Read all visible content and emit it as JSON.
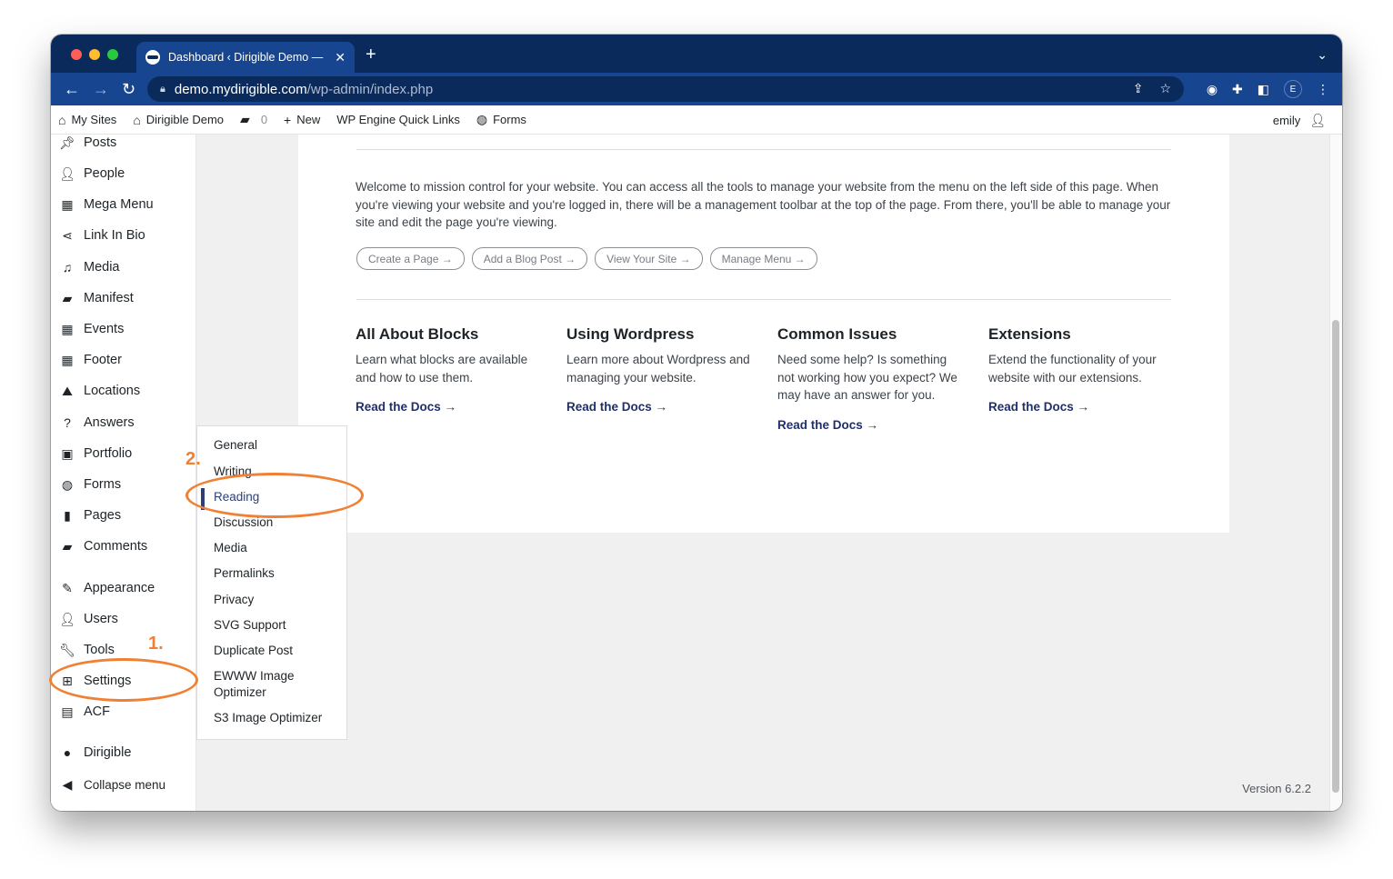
{
  "browser": {
    "tab_title": "Dashboard ‹ Dirigible Demo —",
    "tab_close": "✕",
    "new_tab": "+",
    "url_host": "demo.mydirigible.com",
    "url_path": "/wp-admin/index.php",
    "profile_initial": "E"
  },
  "adminbar": {
    "my_sites": "My Sites",
    "site_name": "Dirigible Demo",
    "comments_count": "0",
    "new_label": "New",
    "wp_engine": "WP Engine Quick Links",
    "forms": "Forms",
    "user": "emily"
  },
  "sidebar": {
    "items": [
      {
        "label": "Posts",
        "icon": "pin-icon"
      },
      {
        "label": "People",
        "icon": "person-icon"
      },
      {
        "label": "Mega Menu",
        "icon": "grid-icon"
      },
      {
        "label": "Link In Bio",
        "icon": "share-icon"
      },
      {
        "label": "Media",
        "icon": "media-icon"
      },
      {
        "label": "Manifest",
        "icon": "folder-icon"
      },
      {
        "label": "Events",
        "icon": "calendar-icon"
      },
      {
        "label": "Footer",
        "icon": "grid-icon"
      },
      {
        "label": "Locations",
        "icon": "map-icon"
      },
      {
        "label": "Answers",
        "icon": "question-icon"
      },
      {
        "label": "Portfolio",
        "icon": "portfolio-icon"
      },
      {
        "label": "Forms",
        "icon": "forms-icon"
      },
      {
        "label": "Pages",
        "icon": "pages-icon"
      },
      {
        "label": "Comments",
        "icon": "comment-icon"
      },
      {
        "label": "Appearance",
        "icon": "brush-icon"
      },
      {
        "label": "Users",
        "icon": "person-icon"
      },
      {
        "label": "Tools",
        "icon": "wrench-icon"
      },
      {
        "label": "Settings",
        "icon": "settings-icon"
      },
      {
        "label": "ACF",
        "icon": "acf-icon"
      },
      {
        "label": "Dirigible",
        "icon": "dirigible-icon"
      },
      {
        "label": "Collapse menu",
        "icon": "collapse-icon"
      }
    ]
  },
  "welcome": {
    "text": "Welcome to mission control for your website. You can access all the tools to manage your website from the menu on the left side of this page. When you're viewing your website and you're logged in, there will be a management toolbar at the top of the page. From there, you'll be able to manage your site and edit the page you're viewing.",
    "buttons": [
      "Create a Page →",
      "Add a Blog Post →",
      "View Your Site →",
      "Manage Menu →"
    ]
  },
  "columns": [
    {
      "title": "All About Blocks",
      "text": "Learn what blocks are available and how to use them.",
      "link": "Read the Docs →"
    },
    {
      "title": "Using Wordpress",
      "text": "Learn more about Wordpress and managing your website.",
      "link": "Read the Docs →"
    },
    {
      "title": "Common Issues",
      "text": "Need some help? Is something not working how you expect? We may have an answer for you.",
      "link": "Read the Docs →"
    },
    {
      "title": "Extensions",
      "text": "Extend the functionality of your website with our extensions.",
      "link": "Read the Docs →"
    }
  ],
  "settings_submenu": {
    "items": [
      "General",
      "Writing",
      "Reading",
      "Discussion",
      "Media",
      "Permalinks",
      "Privacy",
      "SVG Support",
      "Duplicate Post",
      "EWWW Image Optimizer",
      "S3 Image Optimizer"
    ],
    "active": "Reading"
  },
  "version": "Version 6.2.2",
  "annotations": {
    "step1": "1.",
    "step2": "2.",
    "color": "#f08033"
  }
}
